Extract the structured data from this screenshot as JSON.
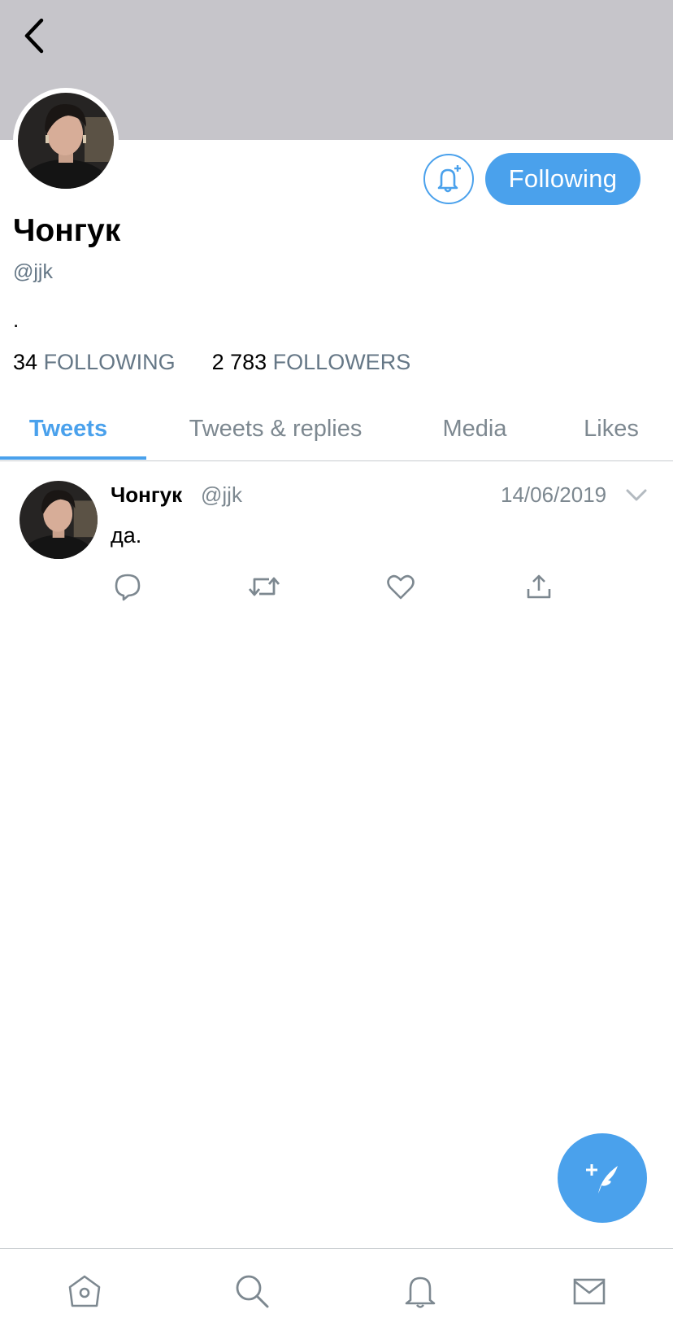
{
  "profile": {
    "display_name": "Чонгук",
    "handle": "@jjk",
    "bio": ".",
    "following_count": "34",
    "following_label": "FOLLOWING",
    "followers_count": "2 783",
    "followers_label": "FOLLOWERS"
  },
  "actions": {
    "following_label": "Following"
  },
  "tabs": [
    {
      "label": "Tweets",
      "active": true
    },
    {
      "label": "Tweets & replies",
      "active": false
    },
    {
      "label": "Media",
      "active": false
    },
    {
      "label": "Likes",
      "active": false
    }
  ],
  "tweet": {
    "name": "Чонгук",
    "handle": "@jjk",
    "date": "14/06/2019",
    "text": "да."
  },
  "icons": {
    "back": "back-arrow-icon",
    "bell": "bell-plus-icon",
    "reply": "reply-icon",
    "retweet": "retweet-icon",
    "like": "heart-icon",
    "share": "share-icon",
    "compose": "compose-tweet-icon",
    "home": "home-icon",
    "search": "search-icon",
    "notifications": "bell-icon",
    "messages": "mail-icon"
  },
  "colors": {
    "accent": "#4aa1ec",
    "banner": "#c6c5ca",
    "muted_text": "#657786"
  }
}
